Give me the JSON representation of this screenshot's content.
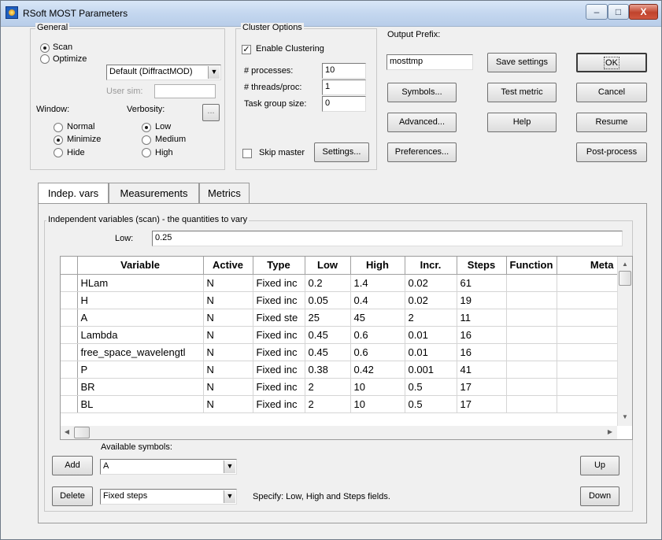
{
  "window": {
    "title": "RSoft MOST Parameters"
  },
  "title_buttons": {
    "minimize": "–",
    "maximize": "□",
    "close": "X"
  },
  "general": {
    "legend": "General",
    "scan_label": "Scan",
    "optimize_label": "Optimize",
    "mode_selected": "Scan",
    "engine_value": "Default (DiffractMOD)",
    "user_sim_label": "User sim:",
    "user_sim_value": "",
    "window_label": "Window:",
    "window_options": [
      "Normal",
      "Minimize",
      "Hide"
    ],
    "window_selected": "Minimize",
    "verbosity_label": "Verbosity:",
    "verbosity_options": [
      "Low",
      "Medium",
      "High"
    ],
    "verbosity_selected": "Low",
    "ellipsis_label": "..."
  },
  "cluster": {
    "legend": "Cluster Options",
    "enable_label": "Enable Clustering",
    "enable_checked": true,
    "processes_label": "# processes:",
    "processes_value": "10",
    "threads_label": "# threads/proc:",
    "threads_value": "1",
    "task_group_label": "Task group size:",
    "task_group_value": "0",
    "skip_master_label": "Skip master",
    "skip_master_checked": false,
    "settings_label": "Settings..."
  },
  "output": {
    "prefix_label": "Output Prefix:",
    "prefix_value": "mosttmp",
    "symbols_label": "Symbols...",
    "advanced_label": "Advanced...",
    "preferences_label": "Preferences..."
  },
  "actions": {
    "save_settings": "Save settings",
    "test_metric": "Test metric",
    "help": "Help",
    "ok": "OK",
    "cancel": "Cancel",
    "resume": "Resume",
    "post_process": "Post-process"
  },
  "tabs": [
    "Indep. vars",
    "Measurements",
    "Metrics"
  ],
  "indep": {
    "legend": "Independent variables (scan) - the quantities to vary",
    "low_label": "Low:",
    "low_value": "0.25",
    "columns": [
      "Variable",
      "Active",
      "Type",
      "Low",
      "High",
      "Incr.",
      "Steps",
      "Function",
      "Meta"
    ],
    "rows": [
      [
        "HLam",
        "N",
        "Fixed inc",
        "0.2",
        "1.4",
        "0.02",
        "61",
        "",
        ""
      ],
      [
        "H",
        "N",
        "Fixed inc",
        "0.05",
        "0.4",
        "0.02",
        "19",
        "",
        ""
      ],
      [
        "A",
        "N",
        "Fixed ste",
        "25",
        "45",
        "2",
        "11",
        "",
        ""
      ],
      [
        "Lambda",
        "N",
        "Fixed inc",
        "0.45",
        "0.6",
        "0.01",
        "16",
        "",
        ""
      ],
      [
        "free_space_wavelengtl",
        "N",
        "Fixed inc",
        "0.45",
        "0.6",
        "0.01",
        "16",
        "",
        ""
      ],
      [
        "P",
        "N",
        "Fixed inc",
        "0.38",
        "0.42",
        "0.001",
        "41",
        "",
        ""
      ],
      [
        "BR",
        "N",
        "Fixed inc",
        "2",
        "10",
        "0.5",
        "17",
        "",
        ""
      ],
      [
        "BL",
        "N",
        "Fixed inc",
        "2",
        "10",
        "0.5",
        "17",
        "",
        ""
      ]
    ],
    "available_symbols_label": "Available symbols:",
    "add_label": "Add",
    "symbol_value": "A",
    "delete_label": "Delete",
    "type_value": "Fixed steps",
    "specify_text": "Specify: Low, High and Steps fields.",
    "up_label": "Up",
    "down_label": "Down"
  }
}
